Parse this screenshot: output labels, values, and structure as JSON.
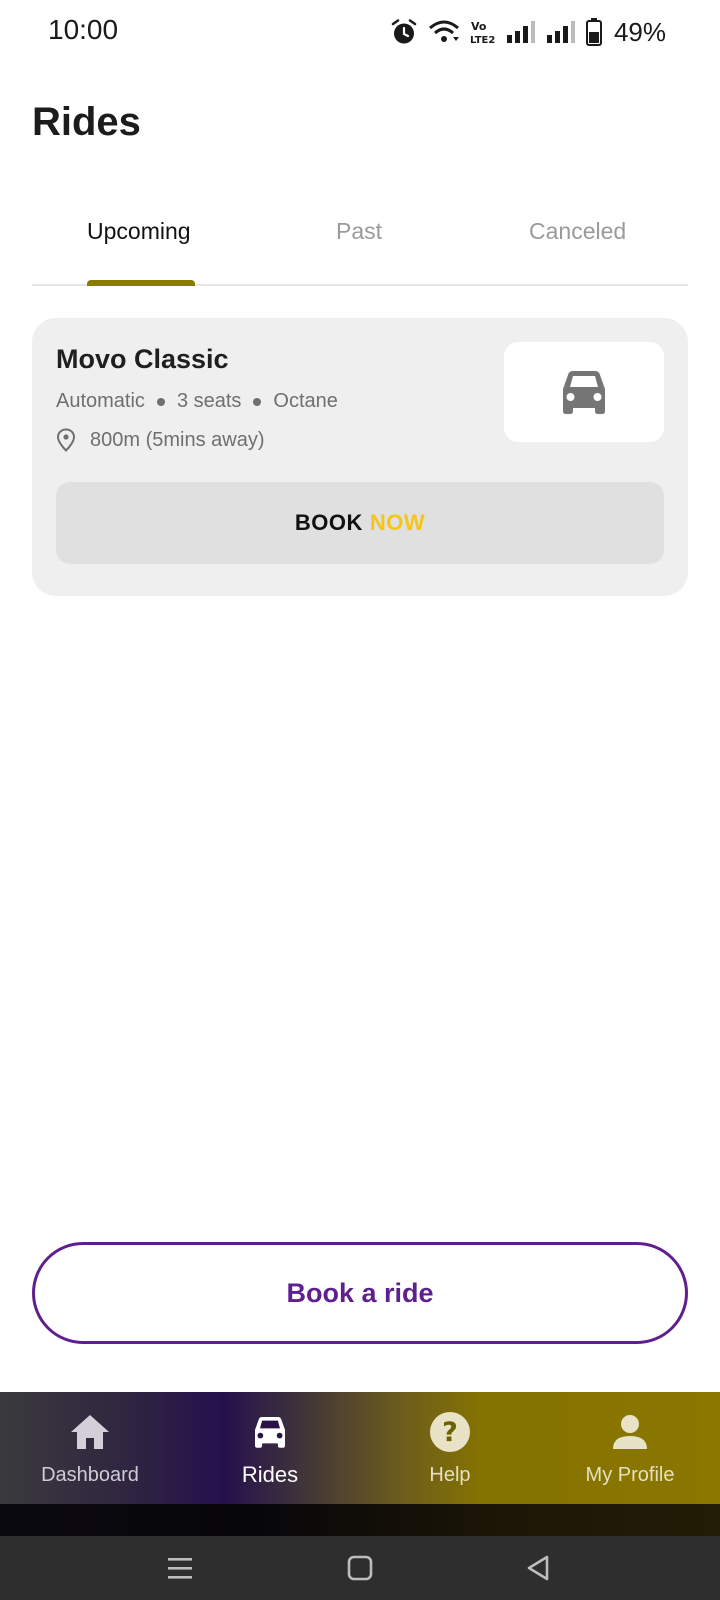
{
  "status_bar": {
    "time": "10:00",
    "battery": "49%"
  },
  "page": {
    "title": "Rides"
  },
  "tabs": [
    {
      "label": "Upcoming",
      "active": true
    },
    {
      "label": "Past",
      "active": false
    },
    {
      "label": "Canceled",
      "active": false
    }
  ],
  "ride_card": {
    "name": "Movo Classic",
    "specs": [
      "Automatic",
      "3 seats",
      "Octane"
    ],
    "distance": "800m (5mins away)",
    "book_label_1": "BOOK",
    "book_label_2": "NOW",
    "image_icon": "car-icon"
  },
  "book_ride_label": "Book a ride",
  "bottom_nav": [
    {
      "label": "Dashboard",
      "icon": "home-icon",
      "active": false
    },
    {
      "label": "Rides",
      "icon": "car-icon",
      "active": true
    },
    {
      "label": "Help",
      "icon": "help-icon",
      "active": false
    },
    {
      "label": "My Profile",
      "icon": "profile-icon",
      "active": false
    }
  ],
  "colors": {
    "accent_purple": "#5f1f8f",
    "tab_indicator": "#8a7a00",
    "now_yellow": "#f5c518"
  }
}
